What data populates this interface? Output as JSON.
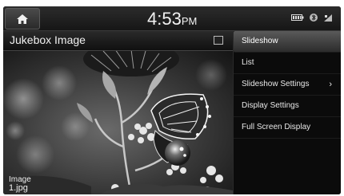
{
  "status": {
    "time": "4:53",
    "ampm": "PM",
    "icons": [
      "battery-icon",
      "bluetooth-icon",
      "signal-icon"
    ]
  },
  "header": {
    "title": "Jukebox Image",
    "icon": "gallery-icon"
  },
  "image": {
    "label": "Image",
    "filename": "1.jpg"
  },
  "menu": {
    "items": [
      {
        "label": "Slideshow",
        "selected": true
      },
      {
        "label": "List"
      },
      {
        "label": "Slideshow Settings",
        "arrow": "›"
      },
      {
        "label": "Display Settings"
      },
      {
        "label": "Full Screen Display"
      }
    ]
  }
}
